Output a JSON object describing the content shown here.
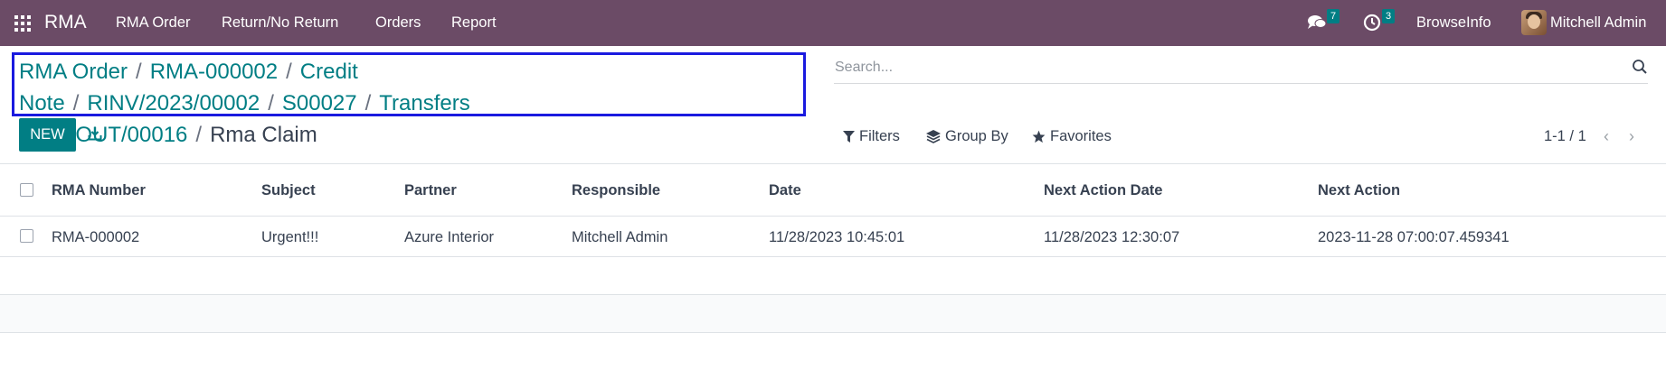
{
  "app": {
    "name": "RMA",
    "menu": [
      "RMA Order",
      "Return/No Return",
      "Orders",
      "Report"
    ],
    "messages_count": "7",
    "activities_count": "3",
    "company": "BrowseInfo",
    "user": "Mitchell Admin"
  },
  "breadcrumbs": {
    "links": [
      "RMA Order",
      "RMA-000002",
      "Credit Note",
      "RINV/2023/00002",
      "S00027",
      "Transfers",
      "WH/OUT/00016"
    ],
    "current": "Rma Claim",
    "separator": "/"
  },
  "search": {
    "placeholder": "Search..."
  },
  "toolbar": {
    "new_label": "NEW"
  },
  "facets": {
    "filters": "Filters",
    "group_by": "Group By",
    "favorites": "Favorites"
  },
  "pager": {
    "value": "1-1 / 1"
  },
  "table": {
    "columns": [
      "RMA Number",
      "Subject",
      "Partner",
      "Responsible",
      "Date",
      "Next Action Date",
      "Next Action"
    ],
    "rows": [
      [
        "RMA-000002",
        "Urgent!!!",
        "Azure Interior",
        "Mitchell Admin",
        "11/28/2023 10:45:01",
        "11/28/2023 12:30:07",
        "2023-11-28 07:00:07.459341"
      ]
    ]
  },
  "colors": {
    "navbar": "#6b4b66",
    "primary": "#017e84",
    "link": "#017e84",
    "highlight_border": "#1a1adf"
  }
}
